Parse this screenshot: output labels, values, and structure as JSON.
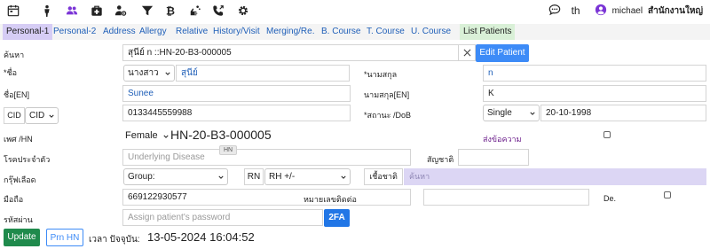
{
  "toolbar": {
    "icons": [
      "calendar-icon",
      "person-icon",
      "users-icon",
      "medical-bag-icon",
      "user-gear-icon",
      "filter-icon",
      "bitcoin-icon",
      "hands-wash-icon",
      "phone-transfer-icon",
      "gear-icon"
    ],
    "lang": "th",
    "user": "michael",
    "branch": "สำนักงานใหญ่"
  },
  "tabs": [
    "Personal-1",
    "Personal-2",
    "Address",
    "Allergy",
    "Relative",
    "History/Visit",
    "Merging/Re.",
    "B. Course",
    "T. Course",
    "U. Course",
    "List Patients"
  ],
  "form": {
    "search_label": "ค้นหา",
    "search_value": "สุนีย์ n ::HN-20-B3-000005",
    "edit_button": "Edit Patient",
    "first_name_label": "*ชื่อ",
    "title_value": "นางสาว",
    "first_name_value": "สุนีย์",
    "last_name_label": "*นามสกุล",
    "last_name_value": "n",
    "first_name_en_label": "ชื่อ[EN]",
    "first_name_en_value": "Sunee",
    "last_name_en_label": "นามสกุล[EN]",
    "last_name_en_value": "K",
    "cid_label": "CID",
    "cid_select": "CID",
    "cid_value": "0133445559988",
    "status_dob_label": "*สถานะ /DoB",
    "marital_value": "Single",
    "dob_value": "20-10-1998",
    "gender_hn_label": "เพศ /HN",
    "gender_value": "Female",
    "hn_value": "HN-20-B3-000005",
    "send_message_link": "ส่งข้อความ",
    "hn_tooltip": "HN",
    "disease_label": "โรคประจำตัว",
    "disease_placeholder": "Underlying Disease",
    "nationality_label": "สัญชาติ",
    "blood_label": "กรุ๊ฟเลือด",
    "blood_group_value": "Group:",
    "rn_label": "RN",
    "rh_value": "RH +/-",
    "race_label": "เชื้อชาติ",
    "race_search_placeholder": "ค้นหา",
    "mobile_label": "มือถือ",
    "mobile_value": "669122930577",
    "phone_label": "หมายเลขติดต่อ",
    "de_label": "De.",
    "password_label": "รหัสผ่าน",
    "password_placeholder": "Assign patient's password",
    "twofa_button": "2FA"
  },
  "footer": {
    "update_button": "Update",
    "print_hn_button": "Prn HN",
    "time_label": "เวลา ปัจจุบัน:",
    "time_value": "13-05-2024 16:04:52"
  },
  "colors": {
    "primary": "#3d8bf7",
    "tab_active": "#d6cdf5",
    "tab_list": "#d9f0d7",
    "update_button": "#1f8a4c",
    "race_search_bg": "#dcd6f4",
    "icon_purple": "#7b35d6"
  }
}
